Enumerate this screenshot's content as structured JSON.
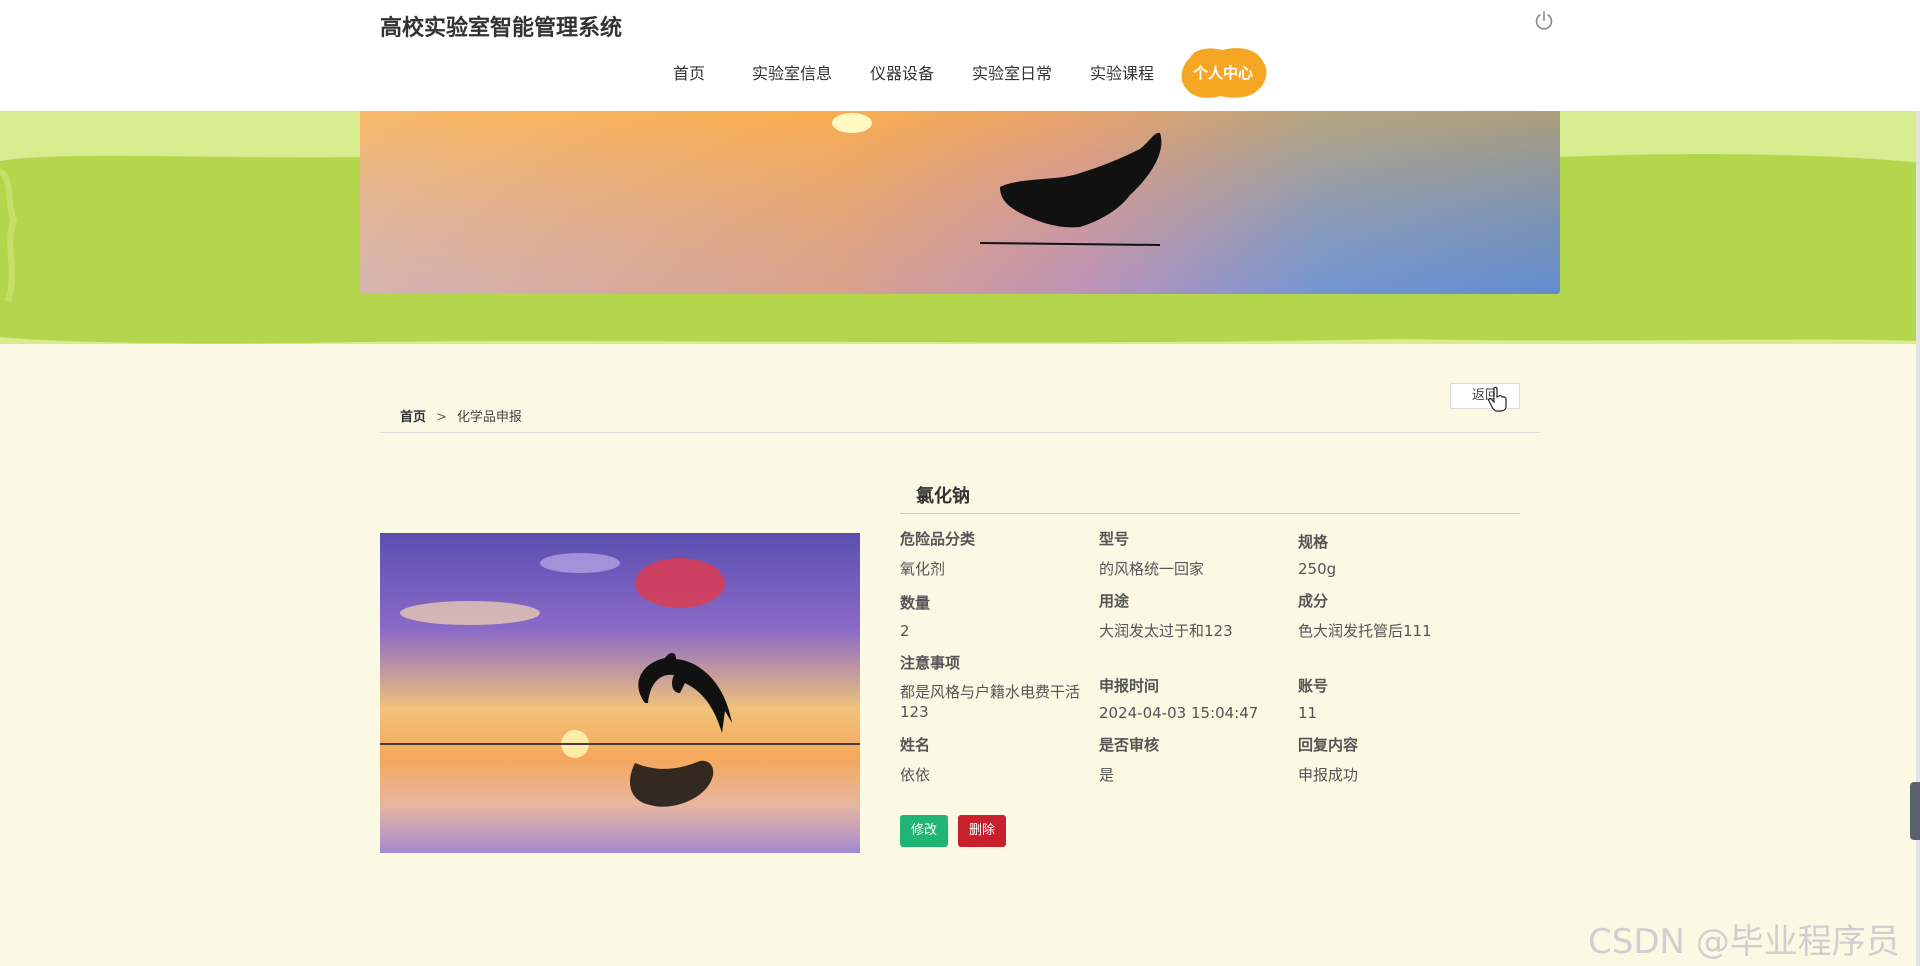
{
  "header": {
    "title": "高校实验室智能管理系统",
    "nav": [
      "首页",
      "实验室信息",
      "仪器设备",
      "实验室日常",
      "实验课程"
    ],
    "active_nav": "个人中心",
    "power_icon": "power-icon"
  },
  "breadcrumb": {
    "home": "首页",
    "separator": ">",
    "current": "化学品申报"
  },
  "back_label": "返回",
  "detail": {
    "name": "氯化钠",
    "fields": [
      {
        "label": "危险品分类",
        "value": "氧化剂"
      },
      {
        "label": "型号",
        "value": "的风格统一回家"
      },
      {
        "label": "规格",
        "value": "250g"
      },
      {
        "label": "数量",
        "value": "2"
      },
      {
        "label": "用途",
        "value": "大润发太过于和123"
      },
      {
        "label": "成分",
        "value": "色大润发托管后111"
      },
      {
        "label": "注意事项",
        "value": "都是风格与户籍水电费干活123"
      },
      {
        "label": "申报时间",
        "value": "2024-04-03 15:04:47"
      },
      {
        "label": "账号",
        "value": "11"
      },
      {
        "label": "姓名",
        "value": "依依"
      },
      {
        "label": "是否审核",
        "value": "是"
      },
      {
        "label": "回复内容",
        "value": "申报成功"
      }
    ]
  },
  "buttons": {
    "edit": "修改",
    "delete": "删除"
  },
  "watermark": "CSDN @毕业程序员",
  "colors": {
    "accent": "#f5a623",
    "band": "#b3d64d",
    "edit": "#21b573",
    "delete": "#c8202d"
  }
}
